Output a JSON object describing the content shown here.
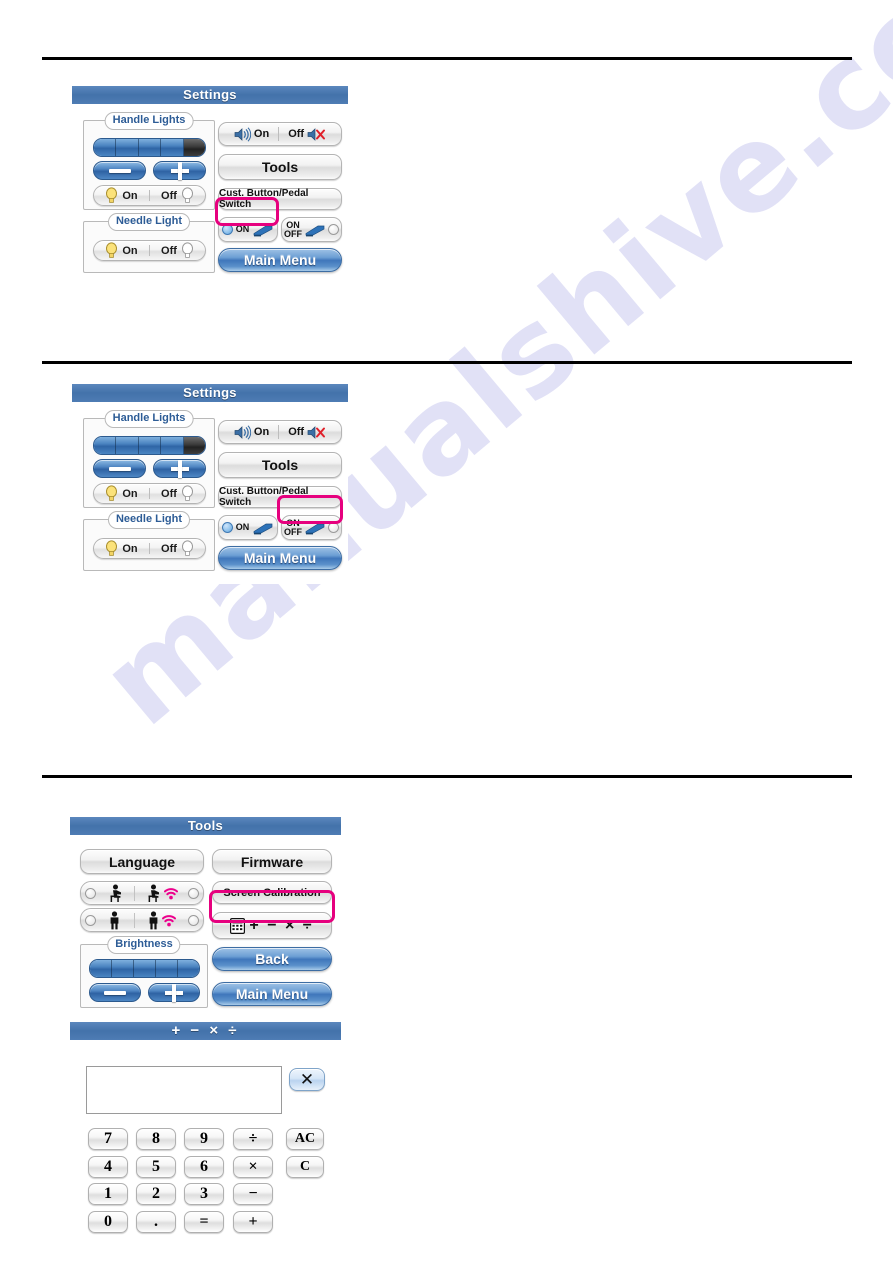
{
  "watermark": {
    "text": "manualshive.com"
  },
  "panels": {
    "settings_1": {
      "title": "Settings",
      "handle_lights": {
        "legend": "Handle Lights",
        "level_segments": 5,
        "level_filled": 4,
        "minus_label": "−",
        "plus_label": "+",
        "on_label": "On",
        "off_label": "Off"
      },
      "needle_light": {
        "legend": "Needle Light",
        "on_label": "On",
        "off_label": "Off"
      },
      "sound": {
        "on_label": "On",
        "off_label": "Off"
      },
      "tools_label": "Tools",
      "cust_button_label": "Cust. Button/Pedal Switch",
      "pedal": {
        "left_label": "ON",
        "right_label_line1": "ON",
        "right_label_line2": "OFF",
        "left_selected": true,
        "highlight": "left"
      },
      "main_menu_label": "Main Menu"
    },
    "settings_2": {
      "title": "Settings",
      "handle_lights": {
        "legend": "Handle Lights",
        "level_segments": 5,
        "level_filled": 4,
        "minus_label": "−",
        "plus_label": "+",
        "on_label": "On",
        "off_label": "Off"
      },
      "needle_light": {
        "legend": "Needle Light",
        "on_label": "On",
        "off_label": "Off"
      },
      "sound": {
        "on_label": "On",
        "off_label": "Off"
      },
      "tools_label": "Tools",
      "cust_button_label": "Cust. Button/Pedal Switch",
      "pedal": {
        "left_label": "ON",
        "right_label_line1": "ON",
        "right_label_line2": "OFF",
        "left_selected": true,
        "highlight": "right"
      },
      "main_menu_label": "Main Menu"
    },
    "tools": {
      "title": "Tools",
      "language_label": "Language",
      "firmware_label": "Firmware",
      "screen_calibration_label": "Screen Calibration",
      "calculator_label": "+ − × ÷",
      "back_label": "Back",
      "main_menu_label": "Main Menu",
      "brightness": {
        "legend": "Brightness",
        "level_segments": 5,
        "level_filled": 5,
        "minus_label": "−",
        "plus_label": "+"
      },
      "posture_rows": [
        {
          "left_icon": "seated-person-icon",
          "right_icon": "seated-person-wireless-icon"
        },
        {
          "left_icon": "standing-person-icon",
          "right_icon": "standing-person-wireless-icon"
        }
      ]
    },
    "calculator": {
      "title": "+ − × ÷",
      "display_value": "",
      "close_label": "✕",
      "keys": [
        [
          "7",
          "8",
          "9",
          "÷",
          "AC"
        ],
        [
          "4",
          "5",
          "6",
          "×",
          "C"
        ],
        [
          "1",
          "2",
          "3",
          "−",
          ""
        ],
        [
          "0",
          ".",
          "=",
          "+",
          ""
        ]
      ]
    }
  },
  "colors": {
    "titlebar_blue": "#4a7cb4",
    "highlight_pink": "#e6007e",
    "wifi_magenta": "#ec008c",
    "bulb_yellow": "#f5d24a",
    "watermark": "#c9c9ef"
  }
}
